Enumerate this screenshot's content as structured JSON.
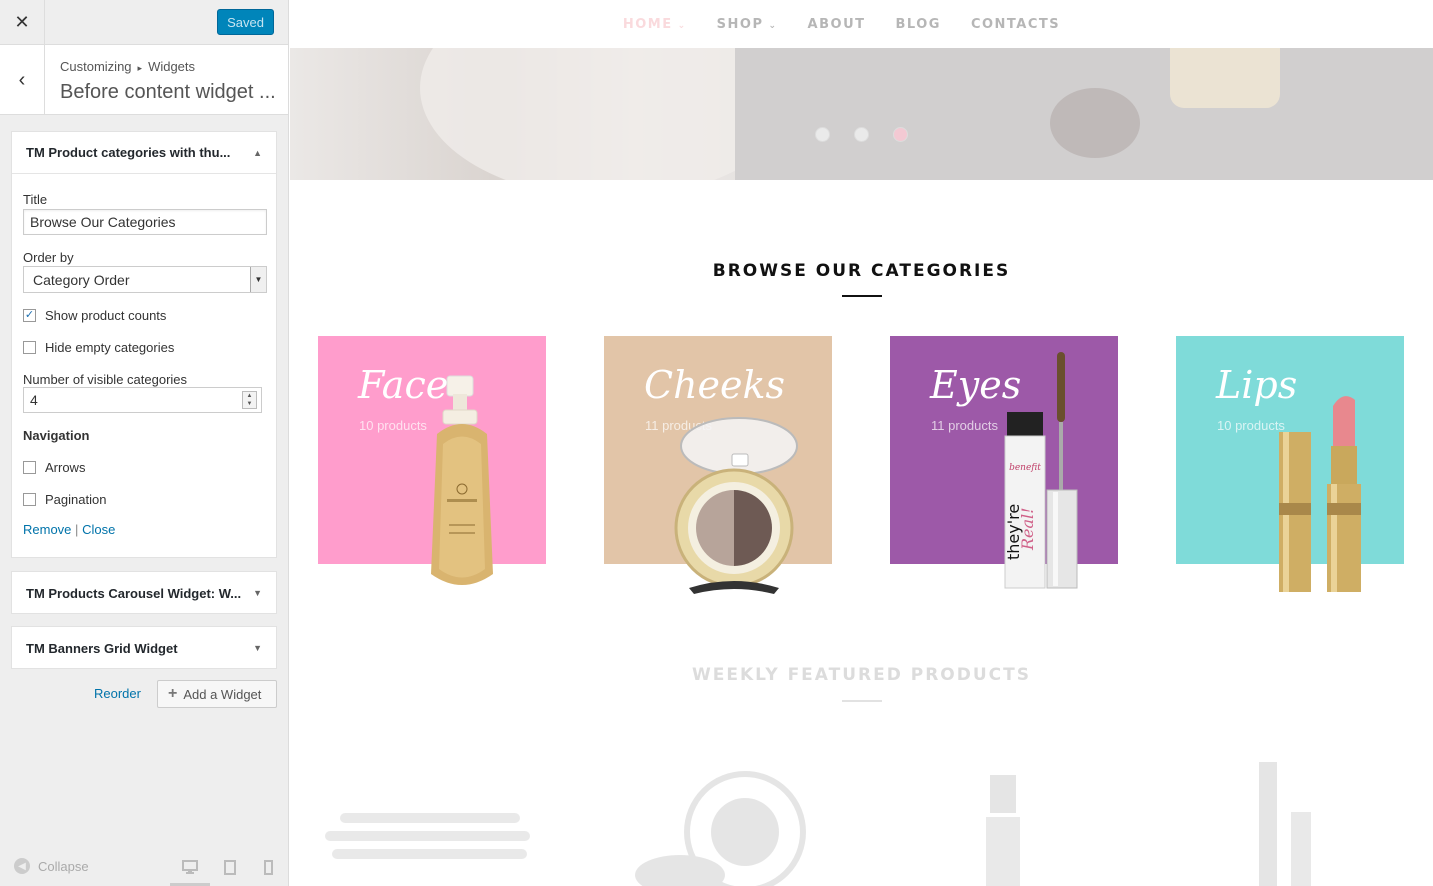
{
  "sidebar": {
    "close_icon": "close-icon",
    "saved_label": "Saved",
    "breadcrumb": {
      "part1": "Customizing",
      "part2": "Widgets"
    },
    "section_title": "Before content widget ...",
    "widget_main": {
      "title": "TM Product categories with thu...",
      "fields": {
        "title_label": "Title",
        "title_value": "Browse Our Categories",
        "order_label": "Order by",
        "order_value": "Category Order",
        "show_counts_label": "Show product counts",
        "show_counts_checked": true,
        "hide_empty_label": "Hide empty categories",
        "hide_empty_checked": false,
        "visible_label": "Number of visible categories",
        "visible_value": "4",
        "navigation_label": "Navigation",
        "arrows_label": "Arrows",
        "pagination_label": "Pagination"
      },
      "remove_label": "Remove",
      "separator": "|",
      "close_label": "Close"
    },
    "widget_2_title": "TM Products Carousel Widget: W...",
    "widget_3_title": "TM Banners Grid Widget",
    "reorder_label": "Reorder",
    "add_widget_label": "Add a Widget",
    "collapse_label": "Collapse"
  },
  "preview": {
    "nav": {
      "home": "HOME",
      "shop": "SHOP",
      "about": "ABOUT",
      "blog": "BLOG",
      "contacts": "CONTACTS"
    },
    "slider_active_dot": 3,
    "categories_title": "BROWSE OUR CATEGORIES",
    "categories": [
      {
        "name": "Face",
        "count": "10 products",
        "color": "#ff9dcc"
      },
      {
        "name": "Cheeks",
        "count": "11 products",
        "color": "#e2c5a8"
      },
      {
        "name": "Eyes",
        "count": "11 products",
        "color": "#9d59a8"
      },
      {
        "name": "Lips",
        "count": "10 products",
        "color": "#7fdbd9"
      }
    ],
    "featured_title": "WEEKLY FEATURED PRODUCTS"
  }
}
